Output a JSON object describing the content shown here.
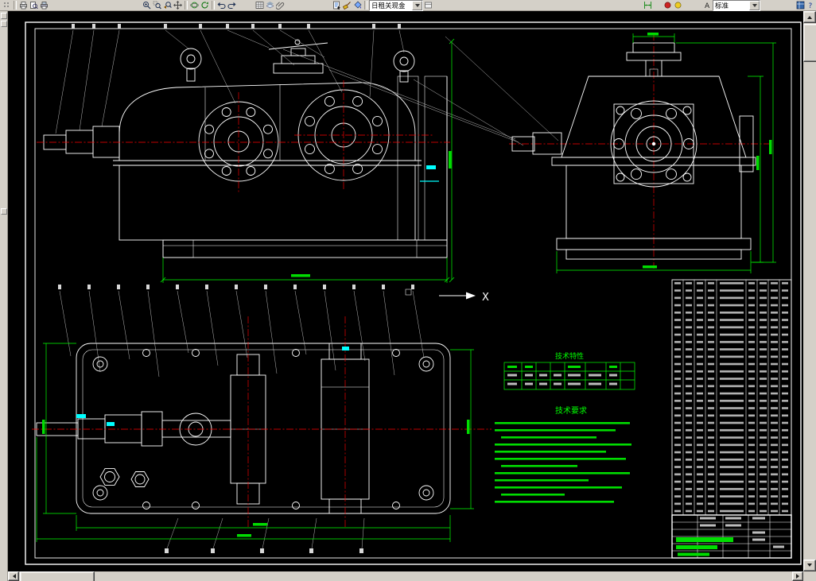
{
  "toolbar": {
    "combo_layer_value": "日租关现金",
    "combo_style_value": "标准",
    "icons": [
      "grip",
      "print",
      "print-preview",
      "plot",
      "zoom-realtime",
      "zoom-window",
      "zoom-previous",
      "pan",
      "orbit",
      "regen",
      "undo",
      "redo",
      "table",
      "layers",
      "attach",
      "properties",
      "match-properties",
      "paint",
      "dim-linear",
      "record",
      "bulb",
      "text-style",
      "palette",
      "help"
    ]
  },
  "drawing": {
    "tech_spec_title": "技术特性",
    "tech_req_title": "技术要求",
    "section_label": "X",
    "colors": {
      "outline": "#ffffff",
      "centerline": "#ff0000",
      "dimension": "#00ff00",
      "highlight": "#00ffff",
      "background": "#000000"
    }
  }
}
